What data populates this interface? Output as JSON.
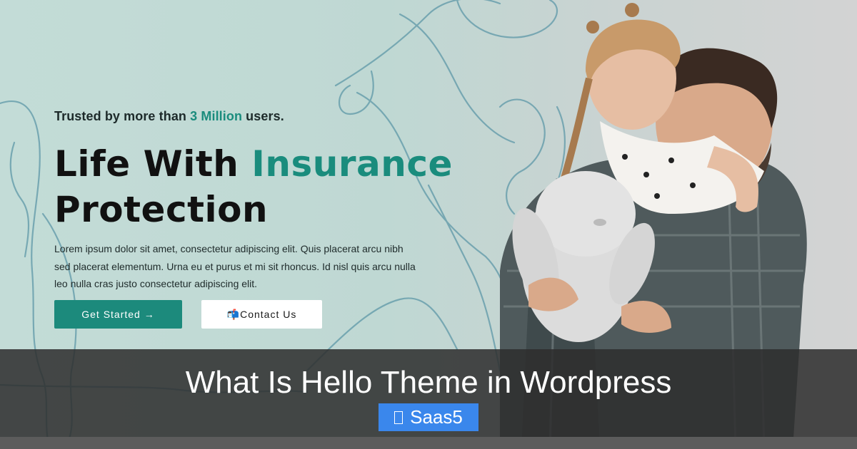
{
  "hero": {
    "trusted_prefix": "Trusted by more than",
    "trusted_highlight": "3 Million",
    "trusted_suffix": "users.",
    "headline_line1": "Life With",
    "headline_highlight": "Insurance",
    "headline_line2": "Protection",
    "body_line1": "Lorem ipsum dolor sit amet, consectetur adipiscing elit. Quis placerat arcu nibh",
    "body_line2": "sed placerat elementum. Urna eu et purus et mi sit rhoncus. Id nisl quis arcu nulla",
    "body_line3": "leo nulla cras justo consectetur adipiscing elit.",
    "get_started_label": "Get Started →",
    "contact_icon": "📬",
    "contact_label": "Contact Us",
    "photo_icon": "family-photo-father-daughter-plush-bunny"
  },
  "overlay": {
    "title": "What Is Hello Theme in Wordpress",
    "tag_icon": "tag-icon",
    "tag_label": "Saas5"
  },
  "colors": {
    "accent": "#1a8c7d",
    "button": "#1c8a7c",
    "tag": "#3a87ec",
    "overlay": "#2d2d2d"
  }
}
